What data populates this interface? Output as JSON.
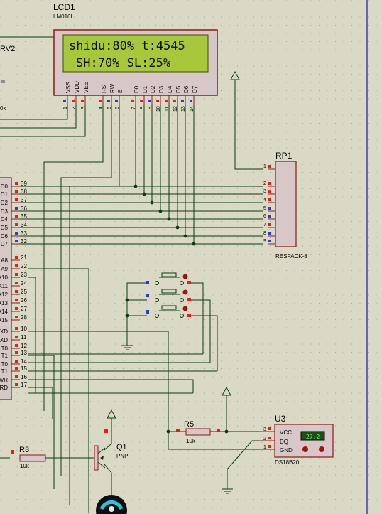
{
  "lcd": {
    "ref": "LCD1",
    "part": "LM016L",
    "line1": "shidu:80% t:4545",
    "line2": "SH:70%  SL:25%",
    "pin_names": [
      "VSS",
      "VDD",
      "VEE",
      "RS",
      "RW",
      "E",
      "D0",
      "D1",
      "D2",
      "D3",
      "D4",
      "D5",
      "D6",
      "D7"
    ],
    "pin_numbers": [
      "1",
      "2",
      "3",
      "4",
      "5",
      "6",
      "7",
      "8",
      "9",
      "10",
      "11",
      "12",
      "13",
      "14"
    ]
  },
  "rv2": {
    "ref": "RV2",
    "value": "0k"
  },
  "rp1": {
    "ref": "RP1",
    "part": "RESPACK-8",
    "pins": [
      "1",
      "2",
      "3",
      "4",
      "5",
      "6",
      "7",
      "8",
      "9"
    ]
  },
  "mcu": {
    "pins": [
      {
        "name": "D0",
        "num": "39"
      },
      {
        "name": "D1",
        "num": "38"
      },
      {
        "name": "D2",
        "num": "37"
      },
      {
        "name": "D3",
        "num": "36"
      },
      {
        "name": "D4",
        "num": "35"
      },
      {
        "name": "D5",
        "num": "34"
      },
      {
        "name": "D6",
        "num": "33"
      },
      {
        "name": "D7",
        "num": "32"
      },
      {
        "name": "A8",
        "num": "21"
      },
      {
        "name": "A9",
        "num": "22"
      },
      {
        "name": "A10",
        "num": "23"
      },
      {
        "name": "A11",
        "num": "24"
      },
      {
        "name": "A12",
        "num": "25"
      },
      {
        "name": "A13",
        "num": "26"
      },
      {
        "name": "A14",
        "num": "27"
      },
      {
        "name": "A15",
        "num": "28"
      },
      {
        "name": "XD",
        "num": "10"
      },
      {
        "name": "XD",
        "num": "11"
      },
      {
        "name": "T0",
        "num": "12"
      },
      {
        "name": "T1",
        "num": "13"
      },
      {
        "name": "T0",
        "num": "14"
      },
      {
        "name": "T1",
        "num": "15"
      },
      {
        "name": "WR",
        "num": "16"
      },
      {
        "name": "RD",
        "num": "17"
      }
    ]
  },
  "r5": {
    "ref": "R5",
    "value": "10k"
  },
  "u3": {
    "ref": "U3",
    "part": "DS18B20",
    "pin_names": [
      "VCC",
      "DQ",
      "GND"
    ],
    "pins": [
      "3",
      "2",
      "1"
    ],
    "reading": "27.2"
  },
  "r3": {
    "ref": "R3",
    "value": "10k"
  },
  "q1": {
    "ref": "Q1",
    "type": "PNP"
  }
}
